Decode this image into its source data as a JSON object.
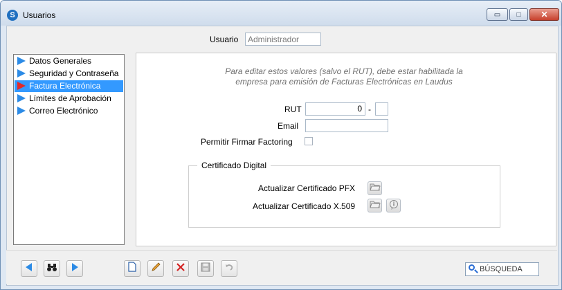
{
  "window": {
    "title": "Usuarios",
    "minimize_glyph": "▭",
    "maximize_glyph": "□",
    "close_glyph": "✕"
  },
  "user": {
    "label": "Usuario",
    "value": "Administrador"
  },
  "nav": {
    "items": [
      {
        "label": "Datos Generales",
        "icon": "blue-triangle-icon"
      },
      {
        "label": "Seguridad y Contraseña",
        "icon": "blue-triangle-icon"
      },
      {
        "label": "Factura Electrónica",
        "icon": "red-triangle-icon",
        "selected": true
      },
      {
        "label": "Límites de Aprobación",
        "icon": "blue-triangle-icon"
      },
      {
        "label": "Correo Electrónico",
        "icon": "blue-triangle-icon"
      }
    ]
  },
  "panel": {
    "note_line1": "Para editar estos valores (salvo el RUT), debe estar habilitada la",
    "note_line2": "empresa para emisión de Facturas Electrónicas en Laudus",
    "rut_label": "RUT",
    "rut_value": "0",
    "rut_dash": "-",
    "rut_dv": "",
    "email_label": "Email",
    "email_value": "",
    "factoring_label": "Permitir Firmar Factoring",
    "factoring_checked": false,
    "cert_group_title": "Certificado Digital",
    "cert_pfx_label": "Actualizar Certificado PFX",
    "cert_x509_label": "Actualizar Certificado X.509"
  },
  "toolbar": {
    "search_label": "BÚSQUEDA",
    "icons": [
      "arrow-left-icon",
      "binoculars-icon",
      "arrow-right-icon",
      "new-document-icon",
      "pencil-icon",
      "delete-x-icon",
      "save-icon",
      "undo-icon",
      "search-icon"
    ]
  },
  "colors": {
    "selection": "#3399ff",
    "nav_arrow": "#2c8be6",
    "selected_arrow": "#e12a2a",
    "close_button": "#c7402c"
  }
}
